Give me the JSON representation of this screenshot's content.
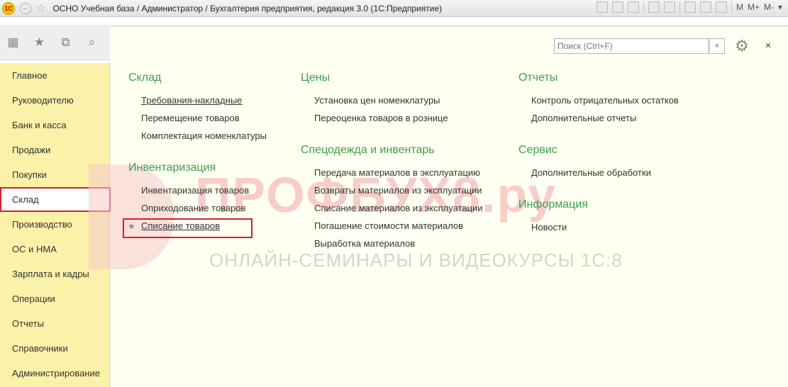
{
  "window": {
    "title": "ОСНО Учебная база / Администратор / Бухгалтерия предприятия, редакция 3.0  (1С:Предприятие)",
    "logo_text": "1С",
    "m_label": "M",
    "m_plus_label": "M+",
    "m_minus_label": "M-"
  },
  "sidebar": {
    "items": [
      {
        "label": "Главное"
      },
      {
        "label": "Руководителю"
      },
      {
        "label": "Банк и касса"
      },
      {
        "label": "Продажи"
      },
      {
        "label": "Покупки"
      },
      {
        "label": "Склад"
      },
      {
        "label": "Производство"
      },
      {
        "label": "ОС и НМА"
      },
      {
        "label": "Зарплата и кадры"
      },
      {
        "label": "Операции"
      },
      {
        "label": "Отчеты"
      },
      {
        "label": "Справочники"
      },
      {
        "label": "Администрирование"
      }
    ],
    "active_index": 5
  },
  "search": {
    "placeholder": "Поиск (Ctrl+F)",
    "clear": "×"
  },
  "close": "×",
  "sections": {
    "sklad": {
      "title": "Склад",
      "links": [
        "Требования-накладные",
        "Перемещение товаров",
        "Комплектация номенклатуры"
      ]
    },
    "inventarizatsiya": {
      "title": "Инвентаризация",
      "links": [
        "Инвентаризация товаров",
        "Оприходование товаров",
        "Списание товаров"
      ]
    },
    "tseny": {
      "title": "Цены",
      "links": [
        "Установка цен номенклатуры",
        "Переоценка товаров в рознице"
      ]
    },
    "spetsodezhda": {
      "title": "Спецодежда и инвентарь",
      "links": [
        "Передача материалов в эксплуатацию",
        "Возвраты материалов из эксплуатации",
        "Списание материалов из эксплуатации",
        "Погашение стоимости материалов",
        "Выработка материалов"
      ]
    },
    "otchety": {
      "title": "Отчеты",
      "links": [
        "Контроль отрицательных остатков",
        "Дополнительные отчеты"
      ]
    },
    "servis": {
      "title": "Сервис",
      "links": [
        "Дополнительные обработки"
      ]
    },
    "informatsiya": {
      "title": "Информация",
      "links": [
        "Новости"
      ]
    }
  },
  "watermark": {
    "main": "ПРОФБУХ8.ру",
    "sub": "ОНЛАЙН-СЕМИНАРЫ И ВИДЕОКУРСЫ 1С:8"
  },
  "colors": {
    "accent_green": "#3a9f4d",
    "sidebar_bg": "#fbf1a8",
    "highlight_red": "#d4202a"
  }
}
